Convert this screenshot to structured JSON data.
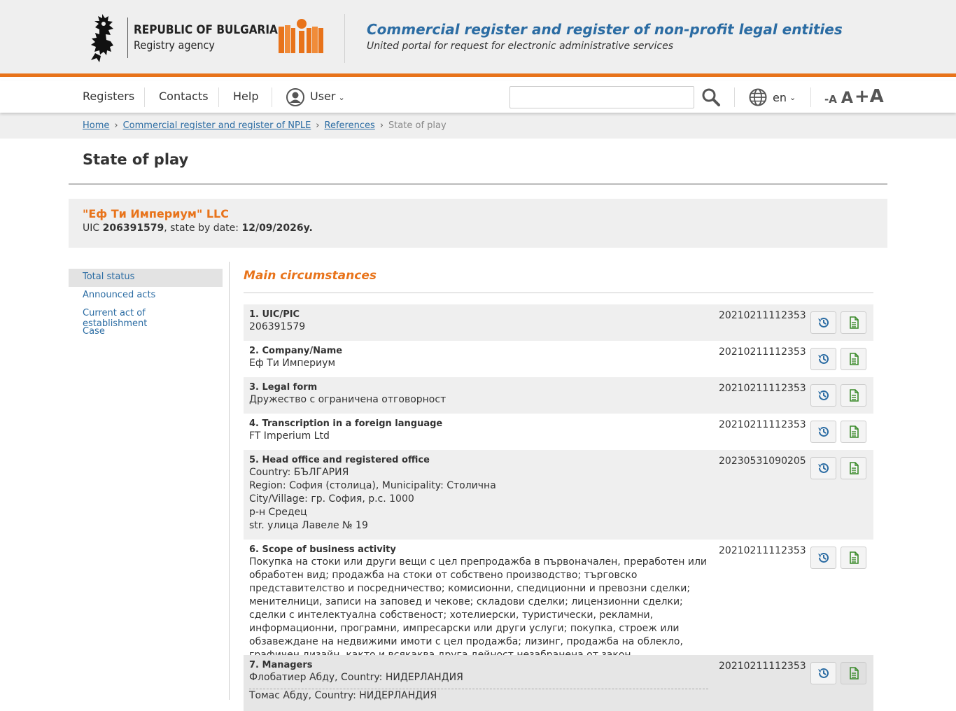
{
  "header": {
    "agency_line1": "REPUBLIC OF BULGARIA",
    "agency_line2": "Registry agency",
    "portal_title": "Commercial register and register of non-profit legal entities",
    "portal_subtitle": "United portal for request for electronic administrative services",
    "accent_color": "#e8731a",
    "link_color": "#2b6ca3"
  },
  "nav": {
    "registers": "Registers",
    "contacts": "Contacts",
    "help": "Help",
    "user": "User",
    "search_placeholder": "",
    "language": "en",
    "font_smaller": "-A",
    "font_normal": "A",
    "font_bigger": "+A"
  },
  "breadcrumb": {
    "home": "Home",
    "register": "Commercial register and register of NPLE",
    "references": "References",
    "current": "State of play"
  },
  "page": {
    "title": "State of play"
  },
  "company": {
    "name": "\"Еф Ти Империум\" LLC",
    "uic_label": "UIC",
    "uic": "206391579",
    "state_label": ", state by date:",
    "state_date": "12/09/2026y."
  },
  "sidebar": {
    "items": [
      {
        "label": "Total status",
        "active": true
      },
      {
        "label": "Announced acts",
        "active": false
      },
      {
        "label": "Current act of establishment",
        "active": false
      },
      {
        "label": "Case",
        "active": false
      }
    ]
  },
  "main": {
    "heading": "Main circumstances",
    "rows": [
      {
        "title": "1. UIC/PIC",
        "lines": [
          "206391579"
        ],
        "entry": "20210211112353"
      },
      {
        "title": "2. Company/Name",
        "lines": [
          "Еф Ти Империум"
        ],
        "entry": "20210211112353"
      },
      {
        "title": "3. Legal form",
        "lines": [
          "Дружество с ограничена отговорност"
        ],
        "entry": "20210211112353"
      },
      {
        "title": "4. Transcription in a foreign language",
        "lines": [
          "FT Imperium Ltd"
        ],
        "entry": "20210211112353"
      },
      {
        "title": "5. Head office and registered office",
        "lines": [
          "Country: БЪЛГАРИЯ",
          "Region: София (столица), Municipality: Столична",
          "City/Village: гр. София, p.c. 1000",
          "р-н Средец",
          "str. улица Лавеле № 19"
        ],
        "entry": "20230531090205"
      },
      {
        "title": "6. Scope of business activity",
        "lines": [
          "Покупка на стоки или други вещи с цел препродажба в първоначален, преработен или обработен вид; продажба на стоки от собствено производство; търговско представителство и посредничество; комисионни, спедиционни и превозни сделки; менителници, записи на заповед и чекове; складови сделки; лицензионни сделки; сделки с интелектуална собственост; хотелиерски, туристически, рекламни, информационни, програмни, импресарски или други услуги; покупка, строеж или обзавеждане на недвижими имоти с цел продажба; лизинг, продажба на облекло, графичен дизайн, както и всякаква друга дейност незабранена от закон."
        ],
        "entry": "20210211112353"
      },
      {
        "title": "7. Managers",
        "lines": [
          "Флобатиер Абду, Country: НИДЕРЛАНДИЯ"
        ],
        "entry": "20210211112353",
        "extra": "Томас Абду, Country: НИДЕРЛАНДИЯ"
      }
    ]
  }
}
